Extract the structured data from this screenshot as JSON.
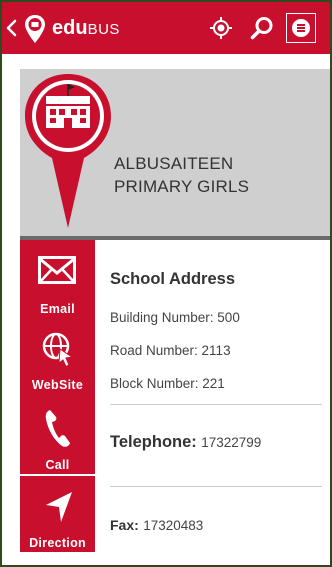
{
  "header": {
    "brand_bold": "edu",
    "brand_light": "BUS"
  },
  "school": {
    "name_line1": "ALBUSAITEEN",
    "name_line2": "PRIMARY GIRLS"
  },
  "actions": [
    {
      "label": "Email",
      "icon": "envelope-icon"
    },
    {
      "label": "WebSite",
      "icon": "globe-cursor-icon"
    },
    {
      "label": "Call",
      "icon": "phone-icon"
    },
    {
      "label": "Direction",
      "icon": "navigation-arrow-icon"
    }
  ],
  "address": {
    "title": "School Address",
    "building": "Building Number: 500",
    "road": "Road Number: 2113",
    "block": "Block Number: 221"
  },
  "contact": {
    "telephone_label": "Telephone:",
    "telephone_value": "17322799",
    "fax_label": "Fax:",
    "fax_value": "17320483"
  },
  "colors": {
    "brand_red": "#c8102e",
    "card_gray": "#cfcfcf",
    "frame_green": "#2e4a1e"
  }
}
